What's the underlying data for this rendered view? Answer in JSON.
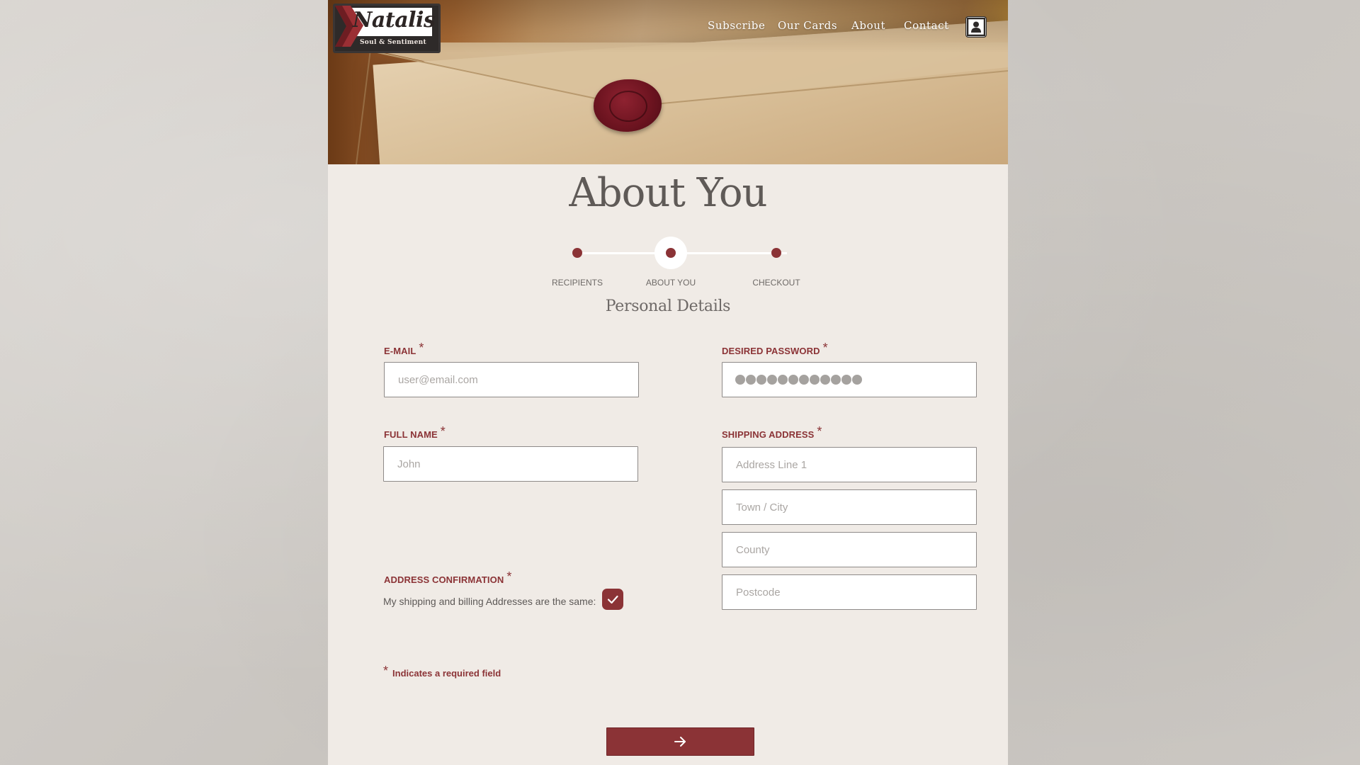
{
  "brand": {
    "name": "Natalis",
    "tagline": "Soul & Sentiment"
  },
  "nav": {
    "items": [
      "Subscribe",
      "Our Cards",
      "About",
      "Contact"
    ],
    "account_icon": "user-account-icon"
  },
  "page": {
    "title": "About You",
    "section_title": "Personal Details"
  },
  "stepper": {
    "steps": [
      "RECIPIENTS",
      "ABOUT YOU",
      "CHECKOUT"
    ],
    "active_index": 1
  },
  "form": {
    "email": {
      "label": "E-MAIL",
      "placeholder": "user@email.com",
      "required": "*"
    },
    "password": {
      "label": "DESIRED PASSWORD",
      "required": "*",
      "masked_length": 12
    },
    "full_name": {
      "label": "FULL NAME",
      "placeholder": "John",
      "required": "*"
    },
    "shipping": {
      "label": "SHIPPING ADDRESS",
      "required": "*",
      "line1_placeholder": "Address Line 1",
      "town_placeholder": "Town / City",
      "county_placeholder": "County",
      "postcode_placeholder": "Postcode"
    },
    "address_confirmation": {
      "label": "ADDRESS CONFIRMATION",
      "required": "*",
      "text": "My shipping and billing Addresses are the same:",
      "checked": true
    },
    "required_note": {
      "star": "*",
      "text": "Indicates a required field"
    },
    "next_button_icon": "arrow-right-icon"
  },
  "colors": {
    "accent": "#8b3336",
    "panel": "#f0ebe6",
    "text": "#5f5a57"
  }
}
